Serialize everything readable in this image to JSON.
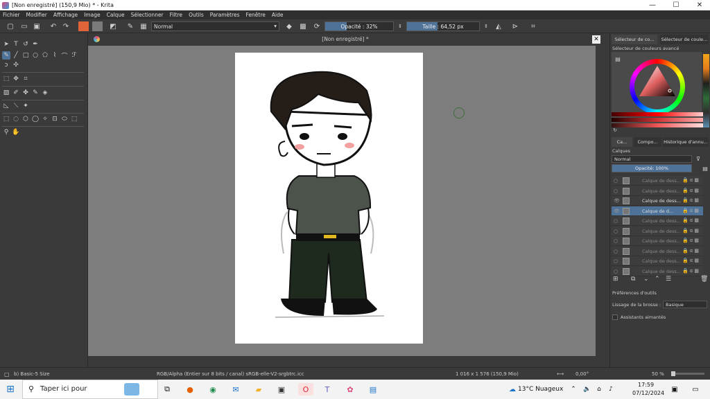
{
  "window": {
    "title": "[Non enregistré]  (150,9 Mio)  * - Krita",
    "minimize": "—",
    "maximize": "☐",
    "close": "✕"
  },
  "menu": {
    "items": [
      "Fichier",
      "Modifier",
      "Affichage",
      "Image",
      "Calque",
      "Sélectionner",
      "Filtre",
      "Outils",
      "Paramètres",
      "Fenêtre",
      "Aide"
    ]
  },
  "toolbar": {
    "blend_mode": "Normal",
    "opacity_label": "Opacité : 32%",
    "opacity_value": 32,
    "size_label": "Taille : 64,52 px",
    "size_value": "64,52 px",
    "fg_color": "#e0633a",
    "bg_color": "#7a7a7a"
  },
  "canvas": {
    "tab_title": "[Non enregistré]  *",
    "close": "✕"
  },
  "right_panel": {
    "tabs": [
      "Sélecteur de co...",
      "Sélecteur de coule..."
    ],
    "color_section": "Sélecteur de couleurs avancé",
    "docker_tabs": [
      "Ca...",
      "Compo...",
      "Historique d'annu..."
    ],
    "layers_title": "Calques",
    "layer_blend": "Normal",
    "layer_opacity": "Opacité:  100%",
    "layer_opacity_value": 100,
    "layers": [
      {
        "name": "Calque de dess...",
        "visible": false,
        "selected": false
      },
      {
        "name": "Calque de dess...",
        "visible": false,
        "selected": false
      },
      {
        "name": "Calque de dess...",
        "visible": true,
        "selected": false
      },
      {
        "name": "Calque de d...",
        "visible": true,
        "selected": true
      },
      {
        "name": "Calque de dess...",
        "visible": false,
        "selected": false
      },
      {
        "name": "Calque de dess...",
        "visible": false,
        "selected": false
      },
      {
        "name": "Calque de dess...",
        "visible": false,
        "selected": false
      },
      {
        "name": "Calque de dess...",
        "visible": false,
        "selected": false
      },
      {
        "name": "Calque de dess...",
        "visible": false,
        "selected": false
      },
      {
        "name": "Calque de dess...",
        "visible": false,
        "selected": false
      }
    ],
    "tool_prefs_title": "Préférences d'outils",
    "smoothing_label": "Lissage de la brosse :",
    "smoothing_value": "Basique",
    "magnetic_assistants": "Assistants aimantés"
  },
  "status": {
    "brush": "b) Basic-5 Size",
    "color_space": "RGB/Alpha (Entier sur 8 bits / canal)  sRGB-elle-V2-srgbtrc.icc",
    "dimensions": "1 016 x 1 576 (150,9 Mio)",
    "rotation": "0,00°",
    "zoom": "50 %"
  },
  "taskbar": {
    "search_placeholder": "Taper ici pour",
    "weather": "13°C  Nuageux",
    "time": "17:59",
    "date": "07/12/2024"
  }
}
